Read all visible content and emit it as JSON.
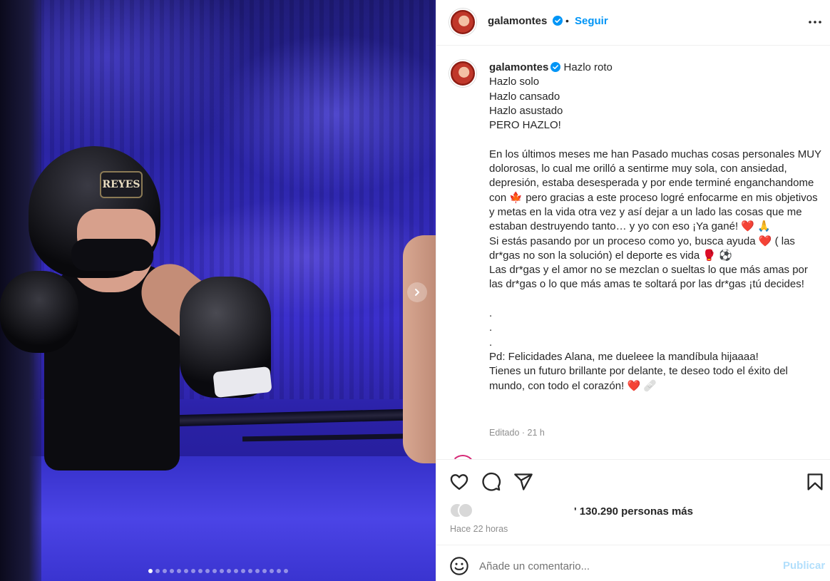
{
  "post": {
    "username": "galamontes",
    "separator": "•",
    "follow_label": "Seguir",
    "more_icon": "more-horizontal-icon",
    "caption_lead": "Hazlo roto",
    "caption_body": "Hazlo solo\nHazlo cansado\nHazlo asustado\nPERO HAZLO!\n\nEn los últimos meses me han Pasado muchas cosas personales MUY dolorosas, lo cual me orilló a sentirme muy sola, con ansiedad, depresión, estaba desesperada y por ende terminé enganchandome con 🍁 pero gracias a este proceso logré enfocarme en mis objetivos y metas en la vida otra vez y así dejar a un lado las cosas que me estaban destruyendo tanto… y yo con eso ¡Ya gané! ❤️ 🙏\nSi estás pasando por un proceso como yo, busca ayuda ❤️ ( las dr*gas no son la solución) el deporte es vida 🥊 ⚽\nLas dr*gas y el amor no se mezclan o sueltas lo que más amas por las dr*gas o lo que más amas te soltará por las dr*gas ¡tú decides!\n\n.\n.\n.\nPd: Felicidades Alana, me dueleee la mandíbula hijaaaa!\nTienes un futuro brillante por delante, te deseo todo el éxito del mundo, con todo el corazón! ❤️ 🩹",
    "edited_label": "Editado · 21 h",
    "likes_text": "130.290 personas más",
    "likes_prefix": "' ",
    "time_ago": "Hace 22 horas"
  },
  "media": {
    "headgear_brand": "REYES",
    "carousel_count": 20,
    "carousel_active_index": 0
  },
  "actions": {
    "like_icon": "heart-icon",
    "comment_icon": "comment-icon",
    "share_icon": "paper-plane-icon",
    "save_icon": "bookmark-icon"
  },
  "comment": {
    "placeholder": "Añade un comentario...",
    "publish_label": "Publicar",
    "emoji_icon": "smiley-icon"
  },
  "colors": {
    "accent": "#0095f6",
    "verified": "#0095f6",
    "publish_disabled": "#b2dffc",
    "meta_text": "#8e8e8e"
  }
}
